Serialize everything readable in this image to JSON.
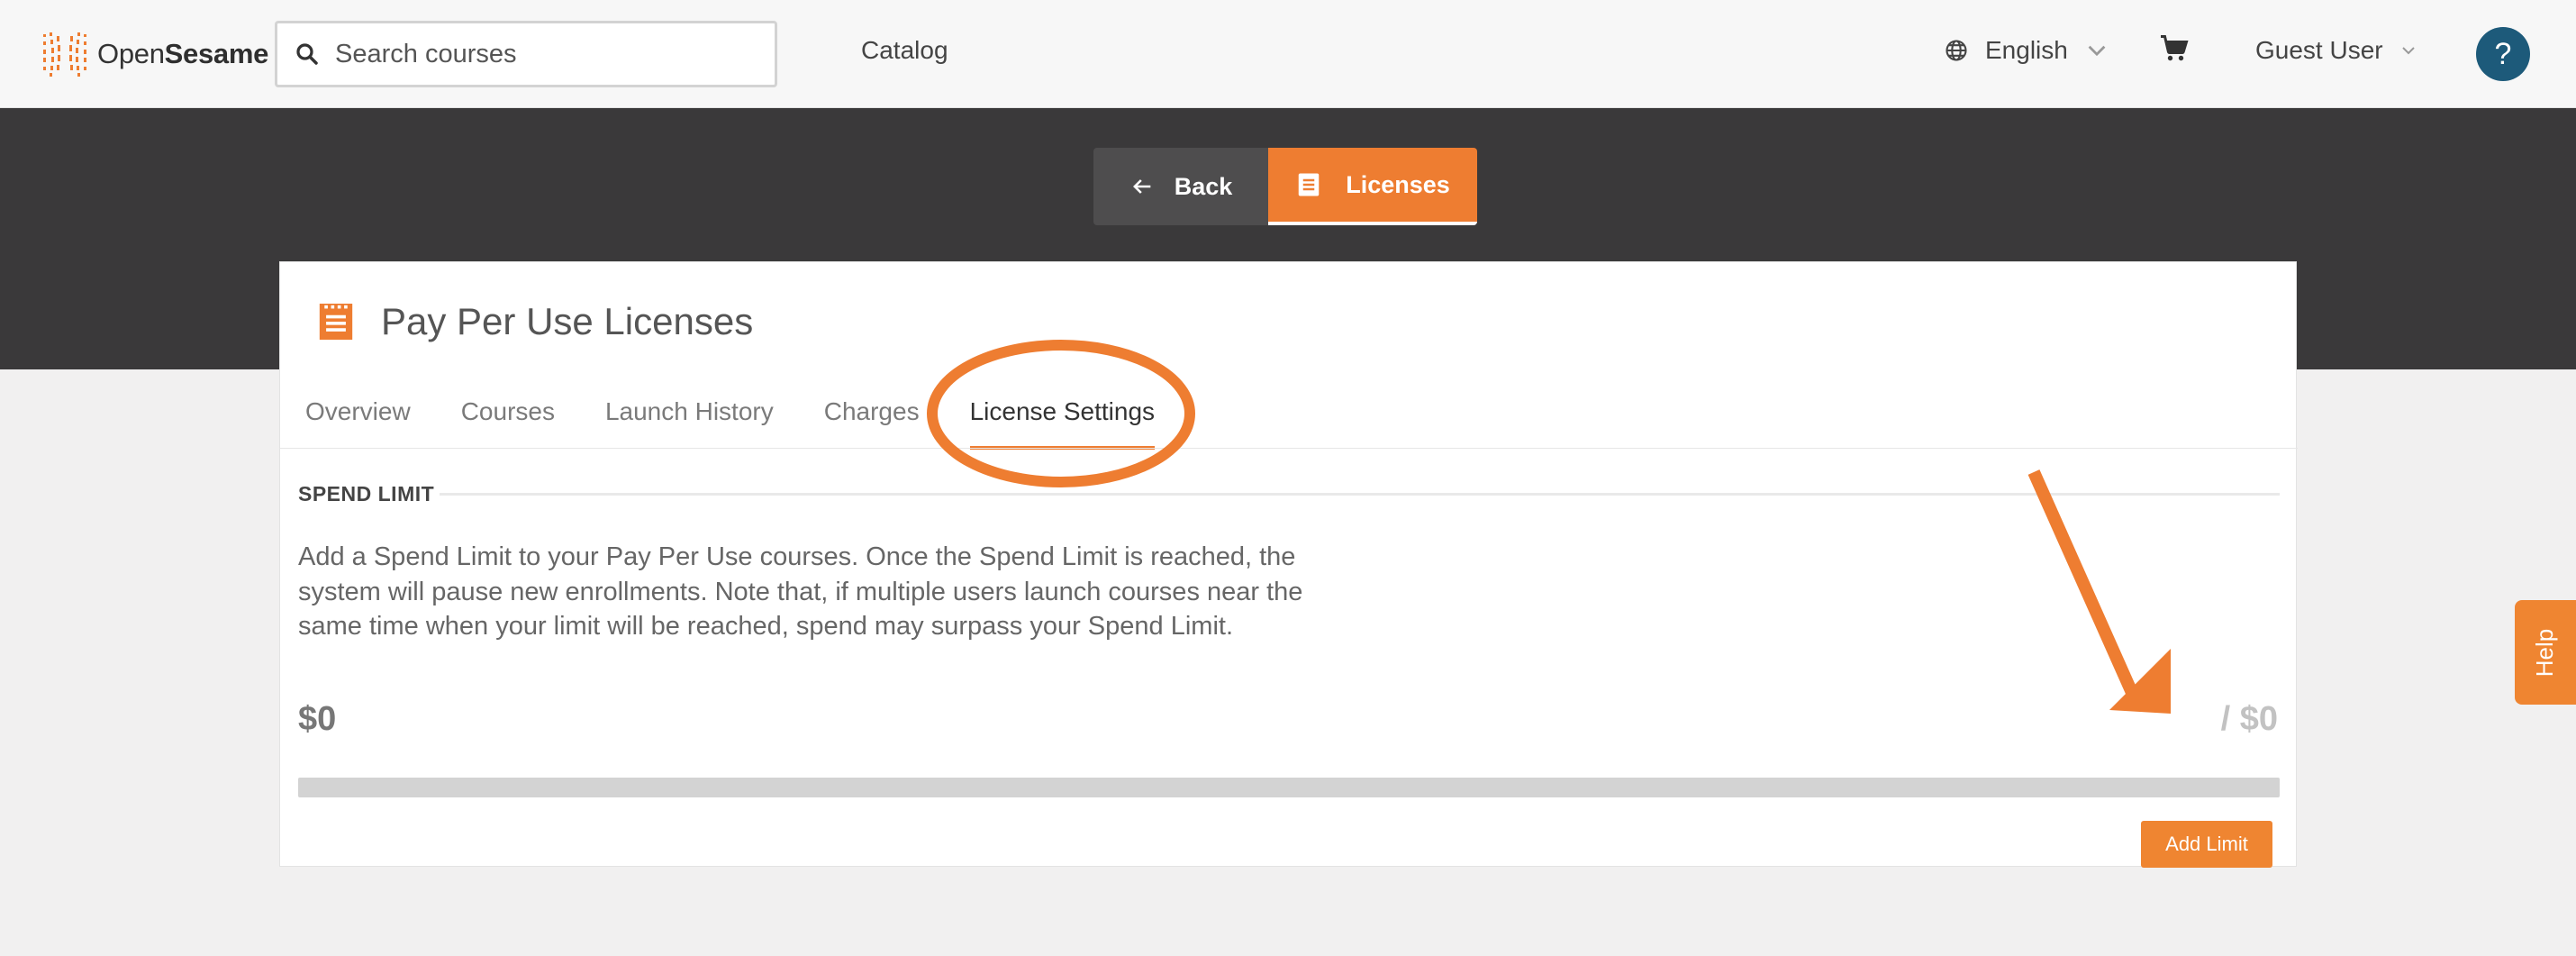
{
  "header": {
    "logo_text_regular": "Open",
    "logo_text_bold": "Sesame",
    "search_placeholder": "Search courses",
    "catalog_label": "Catalog",
    "language_label": "English",
    "user_label": "Guest User",
    "help_button": "?"
  },
  "toolbar": {
    "back_label": "Back",
    "licenses_label": "Licenses"
  },
  "page": {
    "title": "Pay Per Use Licenses",
    "tabs": [
      {
        "label": "Overview"
      },
      {
        "label": "Courses"
      },
      {
        "label": "Launch History"
      },
      {
        "label": "Charges"
      },
      {
        "label": "License Settings",
        "active": true
      }
    ]
  },
  "spend_limit": {
    "section_label": "SPEND LIMIT",
    "description": "Add a Spend Limit to your Pay Per Use courses. Once the Spend Limit is reached, the system will pause new enrollments. Note that, if multiple users launch courses near the same time when your limit will be reached, spend may surpass your Spend Limit.",
    "spent": "$0",
    "limit": "/ $0",
    "progress_percent": 0,
    "add_limit_label": "Add Limit"
  },
  "help_tab_label": "Help",
  "colors": {
    "accent": "#ee7d31",
    "dark_band": "#3a393a",
    "help_circle": "#1d5a7a"
  }
}
